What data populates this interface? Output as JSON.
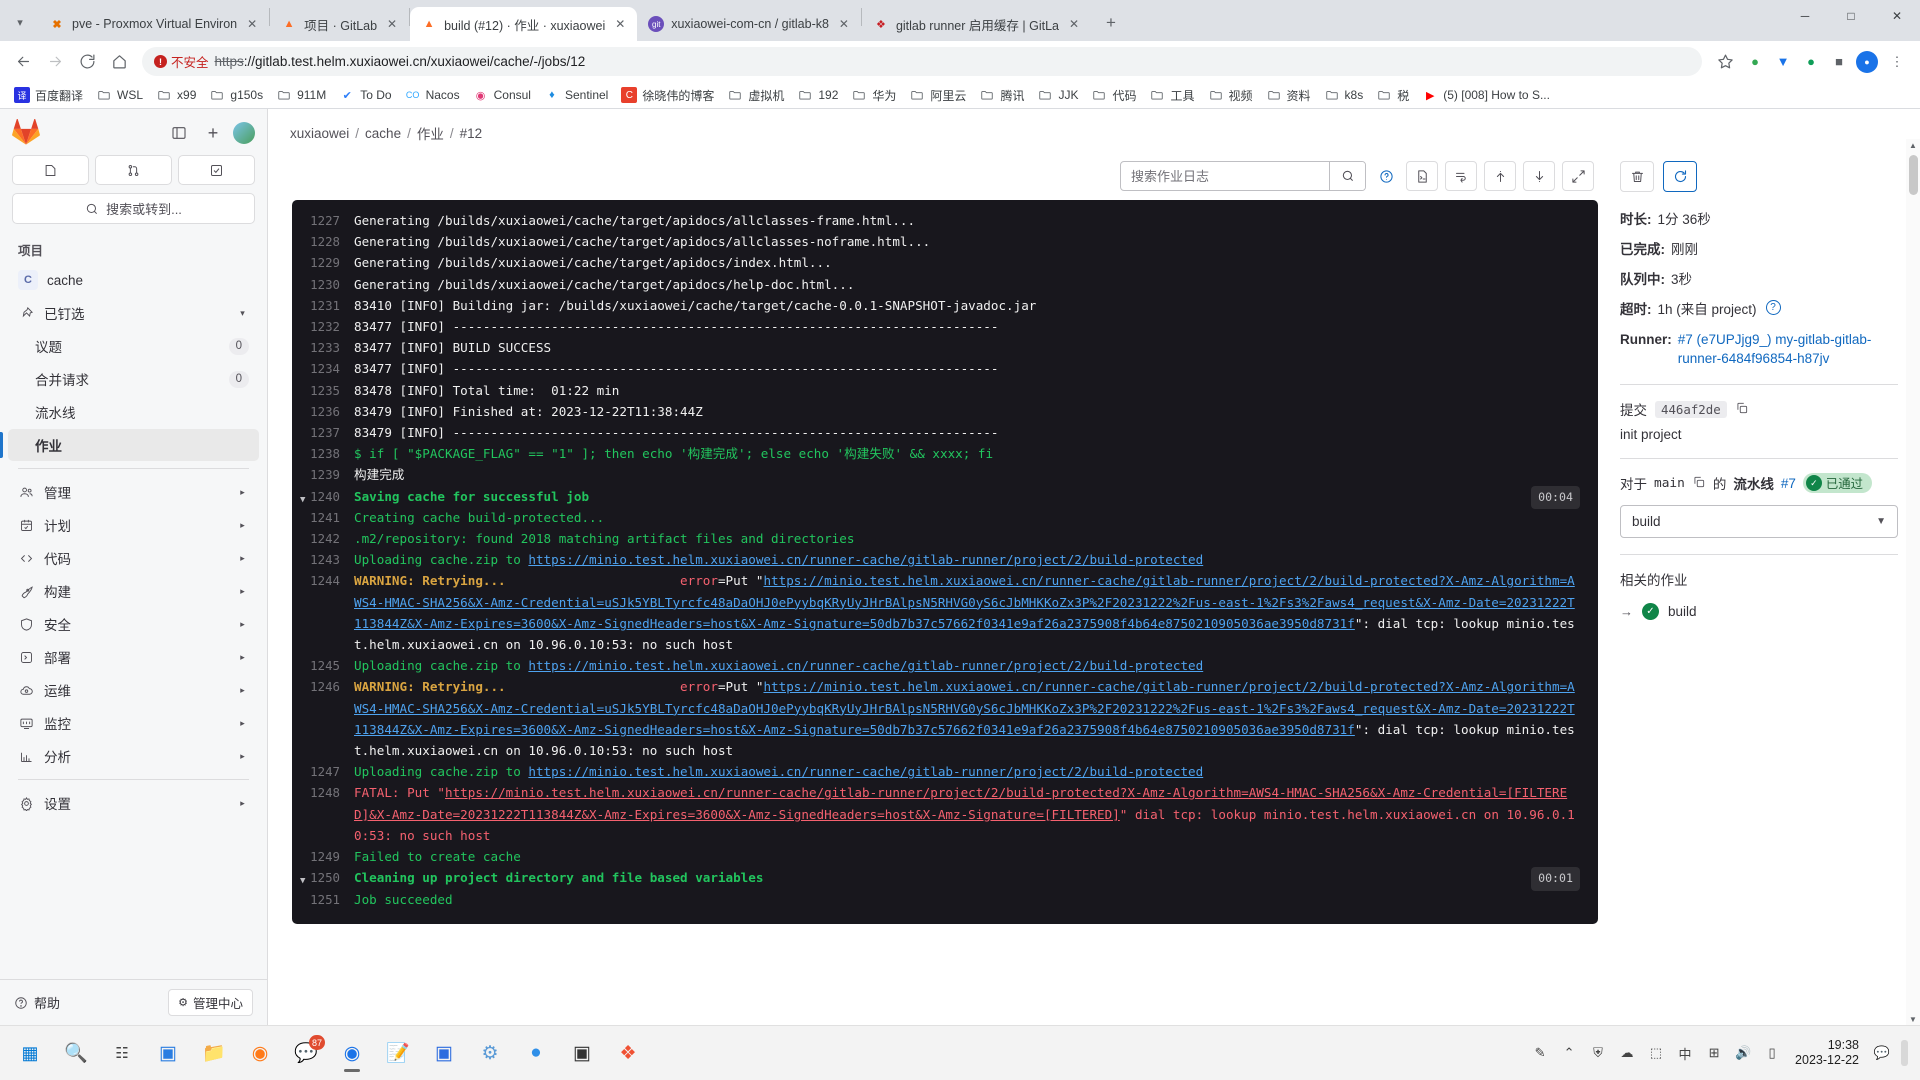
{
  "browser": {
    "tabs": [
      {
        "title": "pve - Proxmox Virtual Environ",
        "favicon": "proxmox-icon",
        "active": false
      },
      {
        "title": "项目 · GitLab",
        "favicon": "gitlab-icon",
        "active": false
      },
      {
        "title": "build (#12) · 作业 · xuxiaowei",
        "favicon": "gitlab-success-icon",
        "active": true
      },
      {
        "title": "xuxiaowei-com-cn / gitlab-k8",
        "favicon": "git-icon",
        "active": false
      },
      {
        "title": "gitlab runner 启用缓存 | GitLa",
        "favicon": "gitee-icon",
        "active": false
      }
    ],
    "new_tab_label": "+",
    "window_controls": {
      "minimize": "─",
      "maximize": "□",
      "close": "✕"
    },
    "nav": {
      "back": "back-arrow",
      "forward": "forward-arrow",
      "reload": "reload-icon",
      "home": "home-icon"
    },
    "address": {
      "security_label": "不安全",
      "scheme": "https",
      "rest": "://gitlab.test.helm.xuxiaowei.cn/xuxiaowei/cache/-/jobs/12",
      "full_url": "https://gitlab.test.helm.xuxiaowei.cn/xuxiaowei/cache/-/jobs/12"
    },
    "bookmarks": [
      {
        "label": "百度翻译",
        "icon": "translate-icon"
      },
      {
        "label": "WSL",
        "icon": "folder-icon"
      },
      {
        "label": "x99",
        "icon": "folder-icon"
      },
      {
        "label": "g150s",
        "icon": "folder-icon"
      },
      {
        "label": "911M",
        "icon": "folder-icon"
      },
      {
        "label": "To Do",
        "icon": "todo-icon"
      },
      {
        "label": "Nacos",
        "icon": "nacos-icon"
      },
      {
        "label": "Consul",
        "icon": "consul-icon"
      },
      {
        "label": "Sentinel",
        "icon": "sentinel-icon"
      },
      {
        "label": "徐晓伟的博客",
        "icon": "blog-icon"
      },
      {
        "label": "虚拟机",
        "icon": "folder-icon"
      },
      {
        "label": "192",
        "icon": "folder-icon"
      },
      {
        "label": "华为",
        "icon": "folder-icon"
      },
      {
        "label": "阿里云",
        "icon": "folder-icon"
      },
      {
        "label": "腾讯",
        "icon": "folder-icon"
      },
      {
        "label": "JJK",
        "icon": "folder-icon"
      },
      {
        "label": "代码",
        "icon": "folder-icon"
      },
      {
        "label": "工具",
        "icon": "folder-icon"
      },
      {
        "label": "视频",
        "icon": "folder-icon"
      },
      {
        "label": "资料",
        "icon": "folder-icon"
      },
      {
        "label": "k8s",
        "icon": "folder-icon"
      },
      {
        "label": "税",
        "icon": "folder-icon"
      },
      {
        "label": "(5) [008] How to S...",
        "icon": "youtube-icon"
      }
    ]
  },
  "sidebar": {
    "logo": "gitlab-logo",
    "search_placeholder": "搜索或转到...",
    "quick_actions": [
      {
        "name": "issues-quick",
        "icon": "issue-icon"
      },
      {
        "name": "merge-requests-quick",
        "icon": "merge-request-icon"
      },
      {
        "name": "todos-quick",
        "icon": "todo-check-icon"
      }
    ],
    "section_title": "项目",
    "project": {
      "initial": "C",
      "name": "cache"
    },
    "pinned_label": "已钉选",
    "pinned_items": [
      {
        "label": "议题",
        "badge": "0"
      },
      {
        "label": "合并请求",
        "badge": "0"
      },
      {
        "label": "流水线",
        "badge": ""
      },
      {
        "label": "作业",
        "badge": "",
        "active": true
      }
    ],
    "nav_items": [
      {
        "label": "管理",
        "icon": "users-icon",
        "chevron": true
      },
      {
        "label": "计划",
        "icon": "calendar-icon",
        "chevron": true
      },
      {
        "label": "代码",
        "icon": "code-icon",
        "chevron": true
      },
      {
        "label": "构建",
        "icon": "rocket-icon",
        "chevron": true
      },
      {
        "label": "安全",
        "icon": "shield-icon",
        "chevron": true
      },
      {
        "label": "部署",
        "icon": "deploy-icon",
        "chevron": true
      },
      {
        "label": "运维",
        "icon": "cloud-gear-icon",
        "chevron": true
      },
      {
        "label": "监控",
        "icon": "monitor-icon",
        "chevron": true
      },
      {
        "label": "分析",
        "icon": "chart-icon",
        "chevron": true
      },
      {
        "label": "设置",
        "icon": "gear-icon",
        "chevron": true
      }
    ],
    "help_label": "帮助",
    "admin_label": "管理中心"
  },
  "breadcrumb": {
    "items": [
      "xuxiaowei",
      "cache",
      "作业",
      "#12"
    ],
    "separator": "/"
  },
  "log_toolbar": {
    "search_placeholder": "搜索作业日志",
    "search_value": "",
    "buttons": [
      {
        "name": "search-submit-button",
        "icon": "search-icon"
      },
      {
        "name": "help-button",
        "icon": "question-circle-icon"
      },
      {
        "name": "raw-log-button",
        "icon": "file-terminal-icon"
      },
      {
        "name": "soft-wrap-button",
        "icon": "wrap-text-icon"
      },
      {
        "name": "scroll-to-top-button",
        "icon": "arrow-up-icon"
      },
      {
        "name": "scroll-to-bottom-button",
        "icon": "arrow-down-icon"
      },
      {
        "name": "fullscreen-button",
        "icon": "expand-icon"
      }
    ]
  },
  "job_log": {
    "lines": [
      {
        "n": "1227",
        "text": "Generating /builds/xuxiaowei/cache/target/apidocs/allclasses-frame.html...",
        "style": "plain"
      },
      {
        "n": "1228",
        "text": "Generating /builds/xuxiaowei/cache/target/apidocs/allclasses-noframe.html...",
        "style": "plain"
      },
      {
        "n": "1229",
        "text": "Generating /builds/xuxiaowei/cache/target/apidocs/index.html...",
        "style": "plain"
      },
      {
        "n": "1230",
        "text": "Generating /builds/xuxiaowei/cache/target/apidocs/help-doc.html...",
        "style": "plain"
      },
      {
        "n": "1231",
        "text": "83410 [INFO] Building jar: /builds/xuxiaowei/cache/target/cache-0.0.1-SNAPSHOT-javadoc.jar",
        "style": "plain"
      },
      {
        "n": "1232",
        "text": "83477 [INFO] ------------------------------------------------------------------------",
        "style": "plain"
      },
      {
        "n": "1233",
        "text": "83477 [INFO] BUILD SUCCESS",
        "style": "plain"
      },
      {
        "n": "1234",
        "text": "83477 [INFO] ------------------------------------------------------------------------",
        "style": "plain"
      },
      {
        "n": "1235",
        "text": "83478 [INFO] Total time:  01:22 min",
        "style": "plain"
      },
      {
        "n": "1236",
        "text": "83479 [INFO] Finished at: 2023-12-22T11:38:44Z",
        "style": "plain"
      },
      {
        "n": "1237",
        "text": "83479 [INFO] ------------------------------------------------------------------------",
        "style": "plain"
      },
      {
        "n": "1238",
        "text": "$ if [ \"$PACKAGE_FLAG\" == \"1\" ]; then echo '构建完成'; else echo '构建失败' && xxxx; fi",
        "style": "cmd"
      },
      {
        "n": "1239",
        "text": "构建完成",
        "style": "plain"
      },
      {
        "n": "1240",
        "text": "Saving cache for successful job",
        "style": "section",
        "collapsible": true,
        "duration": "00:04"
      },
      {
        "n": "1241",
        "text": "Creating cache build-protected...",
        "style": "green"
      },
      {
        "n": "1242",
        "text": ".m2/repository: found 2018 matching artifact files and directories",
        "style": "green"
      },
      {
        "n": "1243",
        "text": "Uploading cache.zip to ",
        "link": "https://minio.test.helm.xuxiaowei.cn/runner-cache/gitlab-runner/project/2/build-protected",
        "style": "green-link"
      },
      {
        "n": "1244",
        "text": "WARNING: Retrying...",
        "style": "warning-long",
        "error_label": "error",
        "error_url": "https://minio.test.helm.xuxiaowei.cn/runner-cache/gitlab-runner/project/2/build-protected?X-Amz-Algorithm=AWS4-HMAC-SHA256&X-Amz-Credential=uSJk5YBLTyrcfc48aDaOHJ0ePyybqKRyUyJHrBAlpsN5RHVG0yS6cJbMHKKoZx3P%2F20231222%2Fus-east-1%2Fs3%2Faws4_request&X-Amz-Date=20231222T113844Z&X-Amz-Expires=3600&X-Amz-SignedHeaders=host&X-Amz-Signature=50db7b37c57662f0341e9af26a2375908f4b64e8750210905036ae3950d8731f",
        "tail": ": dial tcp: lookup minio.test.helm.xuxiaowei.cn on 10.96.0.10:53: no such host"
      },
      {
        "n": "1245",
        "text": "Uploading cache.zip to ",
        "link": "https://minio.test.helm.xuxiaowei.cn/runner-cache/gitlab-runner/project/2/build-protected",
        "style": "green-link"
      },
      {
        "n": "1246",
        "text": "WARNING: Retrying...",
        "style": "warning-long",
        "error_label": "error",
        "error_url": "https://minio.test.helm.xuxiaowei.cn/runner-cache/gitlab-runner/project/2/build-protected?X-Amz-Algorithm=AWS4-HMAC-SHA256&X-Amz-Credential=uSJk5YBLTyrcfc48aDaOHJ0ePyybqKRyUyJHrBAlpsN5RHVG0yS6cJbMHKKoZx3P%2F20231222%2Fus-east-1%2Fs3%2Faws4_request&X-Amz-Date=20231222T113844Z&X-Amz-Expires=3600&X-Amz-SignedHeaders=host&X-Amz-Signature=50db7b37c57662f0341e9af26a2375908f4b64e8750210905036ae3950d8731f",
        "tail": ": dial tcp: lookup minio.test.helm.xuxiaowei.cn on 10.96.0.10:53: no such host"
      },
      {
        "n": "1247",
        "text": "Uploading cache.zip to ",
        "link": "https://minio.test.helm.xuxiaowei.cn/runner-cache/gitlab-runner/project/2/build-protected",
        "style": "green-link"
      },
      {
        "n": "1248",
        "text": "FATAL: Put ",
        "style": "fatal",
        "fatal_url": "https://minio.test.helm.xuxiaowei.cn/runner-cache/gitlab-runner/project/2/build-protected?X-Amz-Algorithm=AWS4-HMAC-SHA256&X-Amz-Credential=[FILTERED]&X-Amz-Date=20231222T113844Z&X-Amz-Expires=3600&X-Amz-SignedHeaders=host&X-Amz-Signature=[FILTERED]",
        "tail": " dial tcp: lookup minio.test.helm.xuxiaowei.cn on 10.96.0.10:53: no such host"
      },
      {
        "n": "1249",
        "text": "Failed to create cache",
        "style": "green"
      },
      {
        "n": "1250",
        "text": "Cleaning up project directory and file based variables",
        "style": "section",
        "collapsible": true,
        "duration": "00:01"
      },
      {
        "n": "1251",
        "text": "Job succeeded",
        "style": "green"
      }
    ]
  },
  "job_panel": {
    "actions": [
      {
        "name": "erase-job-button",
        "icon": "trash-icon"
      },
      {
        "name": "retry-job-button",
        "icon": "retry-icon"
      }
    ],
    "details": [
      {
        "key": "时长:",
        "value": "1分 36秒"
      },
      {
        "key": "已完成:",
        "value": "刚刚"
      },
      {
        "key": "队列中:",
        "value": "3秒"
      },
      {
        "key": "超时:",
        "value": "1h (来自 project)",
        "help": true
      },
      {
        "key": "Runner:",
        "value": "#7 (e7UPJjg9_) my-gitlab-gitlab-runner-6484f96854-h87jv",
        "is_link": true
      }
    ],
    "commit": {
      "label": "提交",
      "sha": "446af2de",
      "message": "init project",
      "copy_icon": "copy-icon"
    },
    "pipeline": {
      "prefix": "对于",
      "branch": "main",
      "middle": "的",
      "pipeline_label": "流水线",
      "number": "#7",
      "status_badge": "已通过",
      "copy_icon": "copy-icon"
    },
    "stage_select": {
      "value": "build",
      "chevron": "chevron-down-icon"
    },
    "related_jobs_title": "相关的作业",
    "related_jobs": [
      {
        "name": "build",
        "status": "passed"
      }
    ]
  },
  "taskbar": {
    "items": [
      {
        "name": "start-button",
        "icon": "windows-icon"
      },
      {
        "name": "search-button",
        "icon": "search-icon"
      },
      {
        "name": "task-view-button",
        "icon": "task-view-icon"
      },
      {
        "name": "widgets-button",
        "icon": "widgets-icon"
      },
      {
        "name": "file-explorer-button",
        "icon": "folder-icon"
      },
      {
        "name": "app-orange-button",
        "icon": "orange-app-icon"
      },
      {
        "name": "wechat-button",
        "icon": "wechat-icon",
        "badge": "87"
      },
      {
        "name": "chrome-button",
        "icon": "chrome-icon",
        "active": true
      },
      {
        "name": "notepad-button",
        "icon": "notepad-icon"
      },
      {
        "name": "idea-button",
        "icon": "idea-icon"
      },
      {
        "name": "settings-button",
        "icon": "gear-icon"
      },
      {
        "name": "feishu-button",
        "icon": "feishu-icon"
      },
      {
        "name": "terminal-button",
        "icon": "terminal-icon"
      },
      {
        "name": "git-button",
        "icon": "git-icon"
      }
    ],
    "tray": [
      {
        "name": "pen-icon",
        "glyph": "✎"
      },
      {
        "name": "tray-overflow-icon",
        "glyph": "⌃"
      },
      {
        "name": "shield-icon",
        "glyph": "⛨"
      },
      {
        "name": "cloud-icon",
        "glyph": "☁"
      },
      {
        "name": "monitor-icon",
        "glyph": "⬚"
      },
      {
        "name": "ime-icon",
        "glyph": "中"
      },
      {
        "name": "network-icon",
        "glyph": "὚7"
      },
      {
        "name": "volume-icon",
        "glyph": "🔊"
      },
      {
        "name": "battery-icon",
        "glyph": "▭"
      },
      {
        "name": "notification-icon",
        "glyph": "💬"
      }
    ],
    "clock": {
      "time": "19:38",
      "date": "2023-12-22"
    }
  }
}
